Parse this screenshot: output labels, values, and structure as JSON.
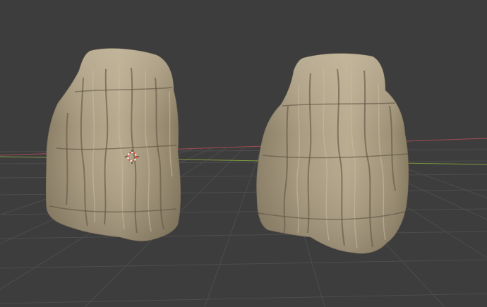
{
  "viewport": {
    "background_color": "#3d3d3d",
    "grid_line_color": "#4d4d4d",
    "x_axis_color": "#a44b55",
    "y_axis_color": "#7f9a3f",
    "rock_base_color": "#a79a80",
    "rock_light_color": "#c3b79d",
    "rock_shadow_color": "#6a5f4c",
    "cursor_colors": [
      "#d94a3a",
      "#f0f0f0"
    ]
  },
  "objects": [
    {
      "name": "rock",
      "icon": "rock-mesh"
    },
    {
      "name": "rock",
      "icon": "rock-mesh"
    }
  ],
  "cursor": {
    "icon": "3d-cursor-icon"
  }
}
